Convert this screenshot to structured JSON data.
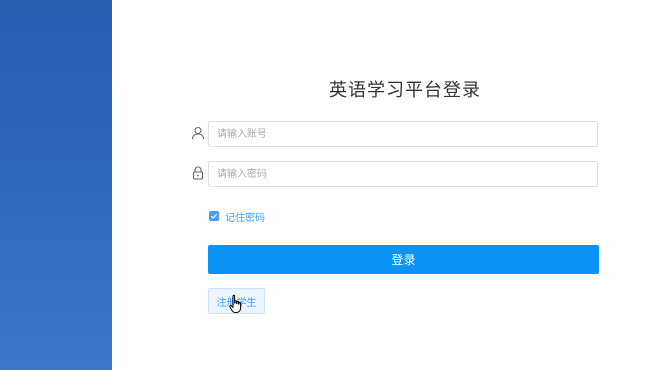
{
  "title": "英语学习平台登录",
  "account": {
    "icon": "user-icon",
    "placeholder": "请输入账号",
    "value": ""
  },
  "password": {
    "icon": "lock-icon",
    "placeholder": "请输入密码",
    "value": ""
  },
  "remember": {
    "label": "记住密码",
    "checked": true
  },
  "login_button": "登录",
  "register_button": "注册学生",
  "colors": {
    "sidebar": "#2d66b8",
    "primary": "#0b93f6",
    "link": "#409eff"
  },
  "cursor": "hand-pointer-icon"
}
